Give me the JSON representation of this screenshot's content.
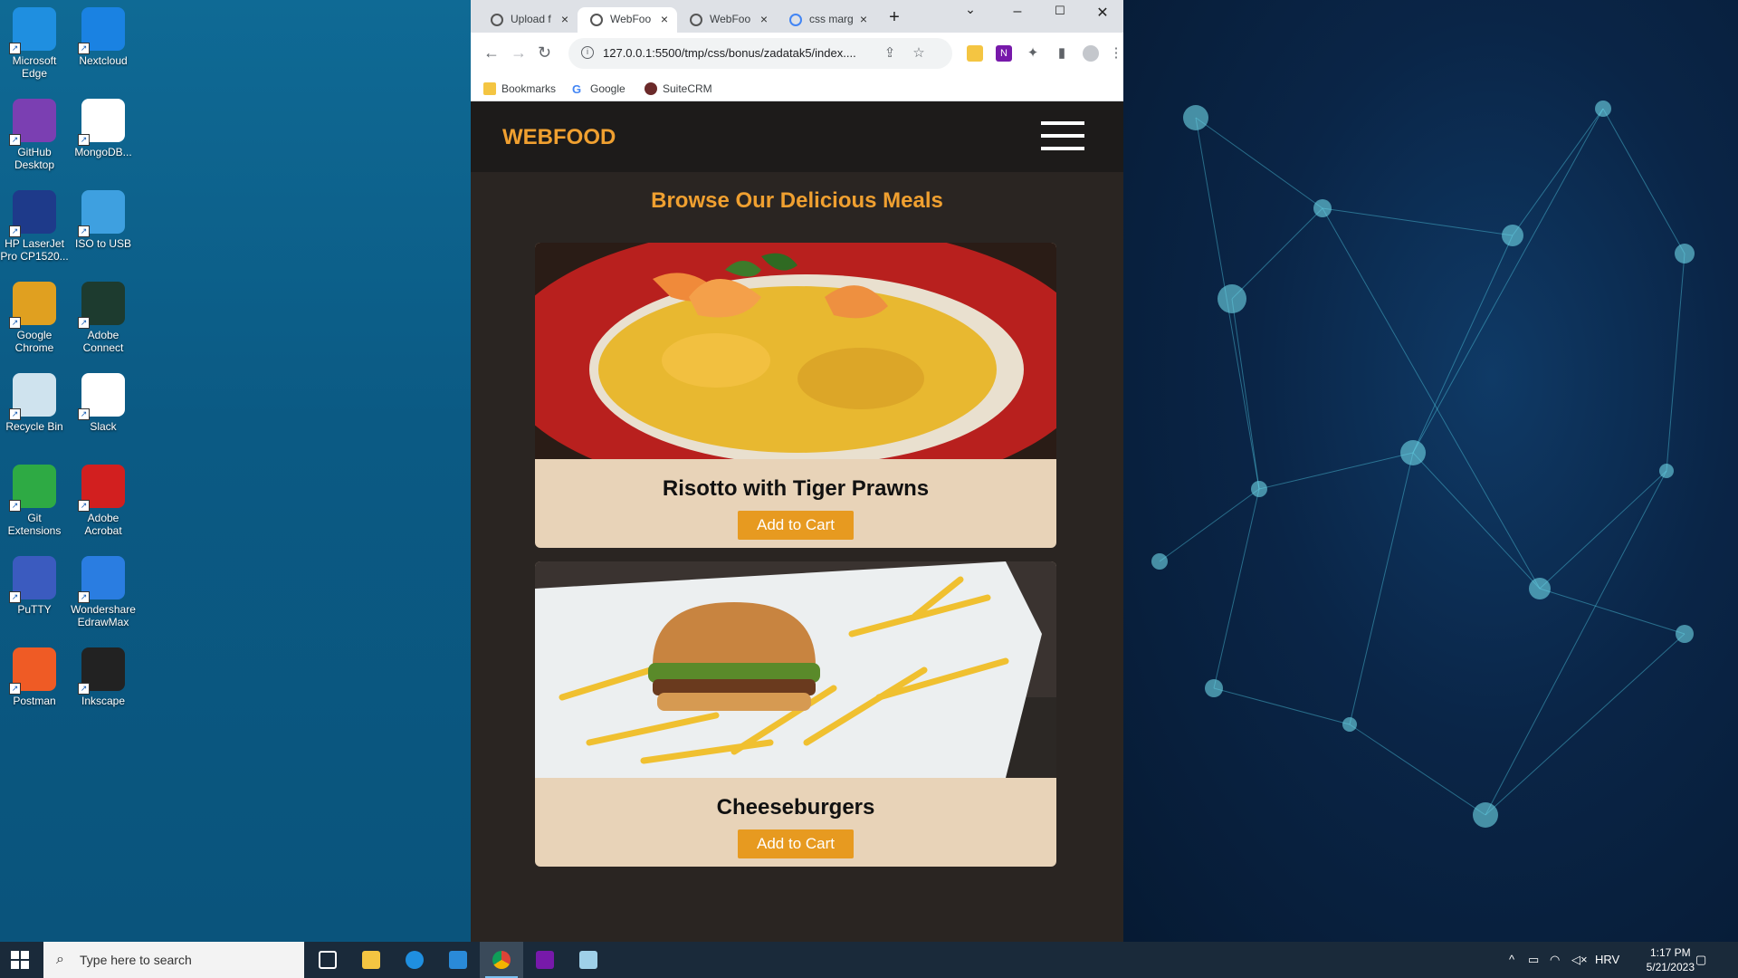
{
  "desktop": {
    "icons": [
      {
        "label": "Microsoft Edge",
        "icon": "edge-icon",
        "color": "#1f8fe0"
      },
      {
        "label": "Nextcloud",
        "icon": "nextcloud-icon",
        "color": "#1a82e2"
      },
      {
        "label": "GitHub Desktop",
        "icon": "github-desktop-icon",
        "color": "#7b3fb2"
      },
      {
        "label": "MongoDB...",
        "icon": "mongodb-icon",
        "color": "#ffffff"
      },
      {
        "label": "HP LaserJet Pro CP1520...",
        "icon": "hp-printer-icon",
        "color": "#1e3a8a"
      },
      {
        "label": "ISO to USB",
        "icon": "iso-to-usb-icon",
        "color": "#3ea0e0"
      },
      {
        "label": "Google Chrome",
        "icon": "chrome-icon",
        "color": "#e0a020"
      },
      {
        "label": "Adobe Connect",
        "icon": "adobe-connect-icon",
        "color": "#1d3b2f"
      },
      {
        "label": "Recycle Bin",
        "icon": "recycle-bin-icon",
        "color": "#cfe3ee"
      },
      {
        "label": "Slack",
        "icon": "slack-icon",
        "color": "#ffffff"
      },
      {
        "label": "Git Extensions",
        "icon": "git-extensions-icon",
        "color": "#2eaa44"
      },
      {
        "label": "Adobe Acrobat",
        "icon": "adobe-acrobat-icon",
        "color": "#d21f1f"
      },
      {
        "label": "PuTTY",
        "icon": "putty-icon",
        "color": "#3b5bbf"
      },
      {
        "label": "Wondershare EdrawMax",
        "icon": "edrawmax-icon",
        "color": "#2a7de1"
      },
      {
        "label": "Postman",
        "icon": "postman-icon",
        "color": "#ef5b25"
      },
      {
        "label": "Inkscape",
        "icon": "inkscape-icon",
        "color": "#222222"
      }
    ]
  },
  "browser": {
    "tabs": [
      {
        "title": "Upload f",
        "icon": "github-icon",
        "active": false
      },
      {
        "title": "WebFoo",
        "icon": "globe-icon",
        "active": true
      },
      {
        "title": "WebFoo",
        "icon": "globe-icon",
        "active": false
      },
      {
        "title": "css marg",
        "icon": "google-icon",
        "active": false
      }
    ],
    "url": "127.0.0.1:5500/tmp/css/bonus/zadatak5/index....",
    "bookmarks": [
      "Bookmarks",
      "Google",
      "SuiteCRM"
    ]
  },
  "site": {
    "logo": "WEBFOOD",
    "page_title": "Browse Our Delicious Meals",
    "meals": [
      {
        "name": "Risotto with Tiger Prawns",
        "button": "Add to Cart"
      },
      {
        "name": "Cheeseburgers",
        "button": "Add to Cart"
      }
    ],
    "accent_color": "#f0a030",
    "button_color": "#e79a20"
  },
  "taskbar": {
    "search_placeholder": "Type here to search",
    "language": "HRV",
    "time": "1:17 PM",
    "date": "5/21/2023"
  }
}
